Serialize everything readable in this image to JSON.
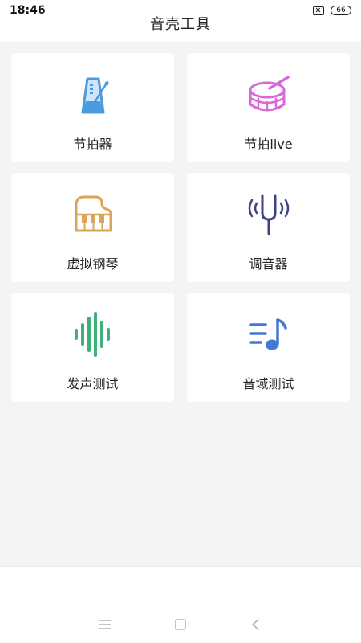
{
  "status_bar": {
    "time": "18:46",
    "battery": "66"
  },
  "header": {
    "title": "音壳工具"
  },
  "tools": [
    {
      "label": "节拍器",
      "icon": "metronome-icon",
      "color": "#4a9be0"
    },
    {
      "label": "节拍live",
      "icon": "drum-icon",
      "color": "#d86ad8"
    },
    {
      "label": "虚拟钢琴",
      "icon": "piano-icon",
      "color": "#d9a55a"
    },
    {
      "label": "调音器",
      "icon": "tuning-fork-icon",
      "color": "#3e4383"
    },
    {
      "label": "发声测试",
      "icon": "sound-wave-icon",
      "color": "#3bb27a"
    },
    {
      "label": "音域测试",
      "icon": "music-note-icon",
      "color": "#4378d6"
    }
  ],
  "nav_icons": [
    "menu-icon",
    "home-icon",
    "back-icon"
  ]
}
